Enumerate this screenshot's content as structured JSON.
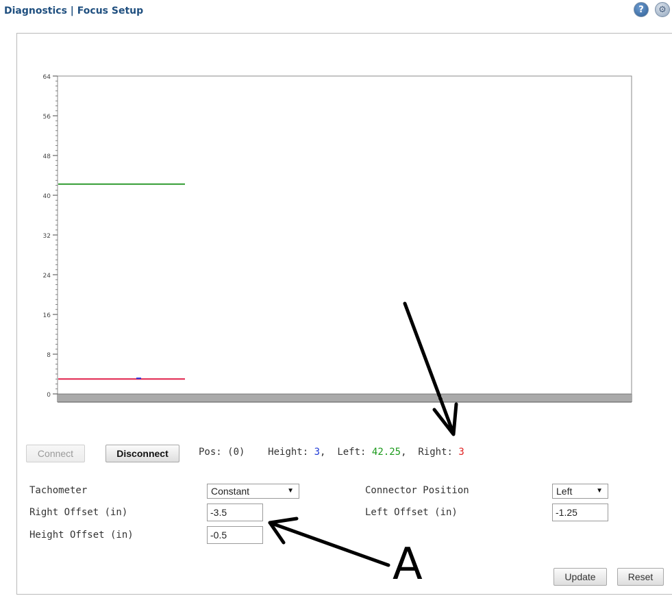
{
  "header": {
    "title": "Diagnostics | Focus Setup",
    "help_icon": "help-icon",
    "settings_icon": "settings-icon"
  },
  "chart_data": {
    "type": "line",
    "ylim": [
      0,
      64
    ],
    "y_ticks": [
      "0",
      "8",
      "16",
      "24",
      "32",
      "40",
      "48",
      "56",
      "64"
    ],
    "series": [
      {
        "color": "#2e9a2e",
        "value": 42.25
      },
      {
        "color": "#e0204a",
        "value": 3
      },
      {
        "color": "#2030e0",
        "value": 3
      }
    ]
  },
  "controls": {
    "connect_label": "Connect",
    "disconnect_label": "Disconnect",
    "pos_text": "Pos: (0)",
    "height_label": "Height: ",
    "height_value": "3",
    "sep1": ",  ",
    "left_label": "Left: ",
    "left_value": "42.25",
    "sep2": ",  ",
    "right_label": "Right: ",
    "right_value": "3"
  },
  "settings": {
    "tachometer_label": "Tachometer",
    "tachometer_value": "Constant",
    "right_offset_label": "Right Offset (in)",
    "right_offset_value": "-3.5",
    "height_offset_label": "Height Offset (in)",
    "height_offset_value": "-0.5",
    "connector_position_label": "Connector Position",
    "connector_position_value": "Left",
    "left_offset_label": "Left Offset (in)",
    "left_offset_value": "-1.25"
  },
  "footer": {
    "update_label": "Update",
    "reset_label": "Reset"
  },
  "annotations": {
    "letter": "A"
  },
  "colors": {
    "title": "#1f4f7f",
    "height": "#1f3ad6",
    "left": "#1b9a1b",
    "right": "#e02020"
  }
}
